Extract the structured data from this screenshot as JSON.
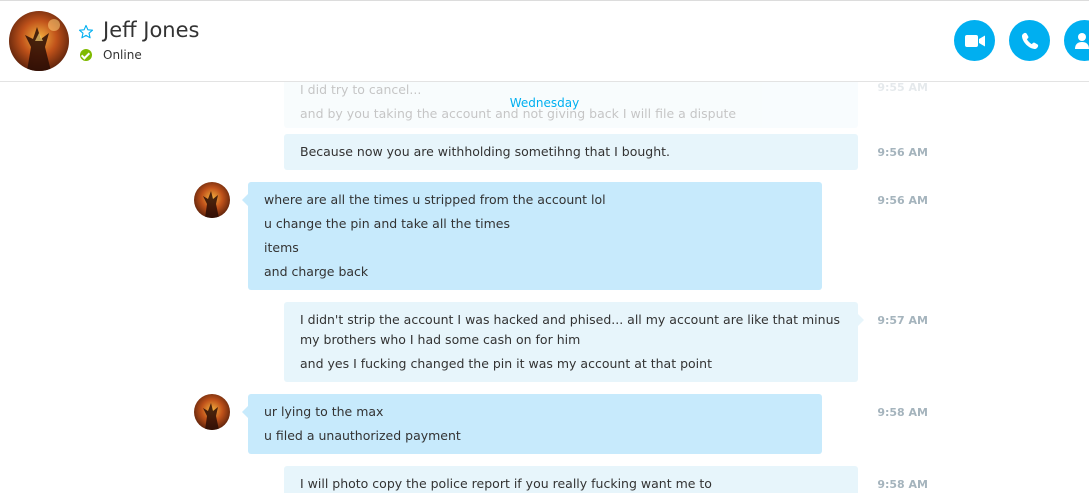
{
  "contact": {
    "name": "Jeff Jones",
    "status": "Online"
  },
  "header_actions": [
    {
      "name": "video-call",
      "icon": "video-icon"
    },
    {
      "name": "voice-call",
      "icon": "phone-icon"
    },
    {
      "name": "add-contact",
      "icon": "add-person-icon"
    }
  ],
  "day_separator": "Wednesday",
  "colors": {
    "accent": "#00aff0",
    "online": "#7fba00",
    "bubble_sent": "#e7f5fb",
    "bubble_received": "#c7eafc",
    "timestamp": "#a5b4bd"
  },
  "messages": [
    {
      "from": "me",
      "lines": [
        "I did try to cancel...",
        "and by you taking the account and not giving back I will file a dispute"
      ],
      "time": "9:55 AM"
    },
    {
      "from": "me",
      "lines": [
        "Because now you are withholding sometihng that I bought."
      ],
      "time": "9:56 AM"
    },
    {
      "from": "them",
      "lines": [
        "where are all the times u stripped from the account lol",
        "u change the pin and take all the times",
        "items",
        "and charge back"
      ],
      "time": "9:56 AM"
    },
    {
      "from": "me",
      "lines": [
        "I didn't strip the account I was hacked and phised... all my account are like that minus my brothers who I had some cash on for him",
        "and yes I fucking changed the pin it was my account at that point"
      ],
      "time": "9:57 AM"
    },
    {
      "from": "them",
      "lines": [
        "ur lying to the max",
        "u filed a unauthorized payment"
      ],
      "time": "9:58 AM"
    },
    {
      "from": "me",
      "lines": [
        "I will photo copy the police report if you really fucking want me to"
      ],
      "time": "9:58 AM"
    }
  ]
}
